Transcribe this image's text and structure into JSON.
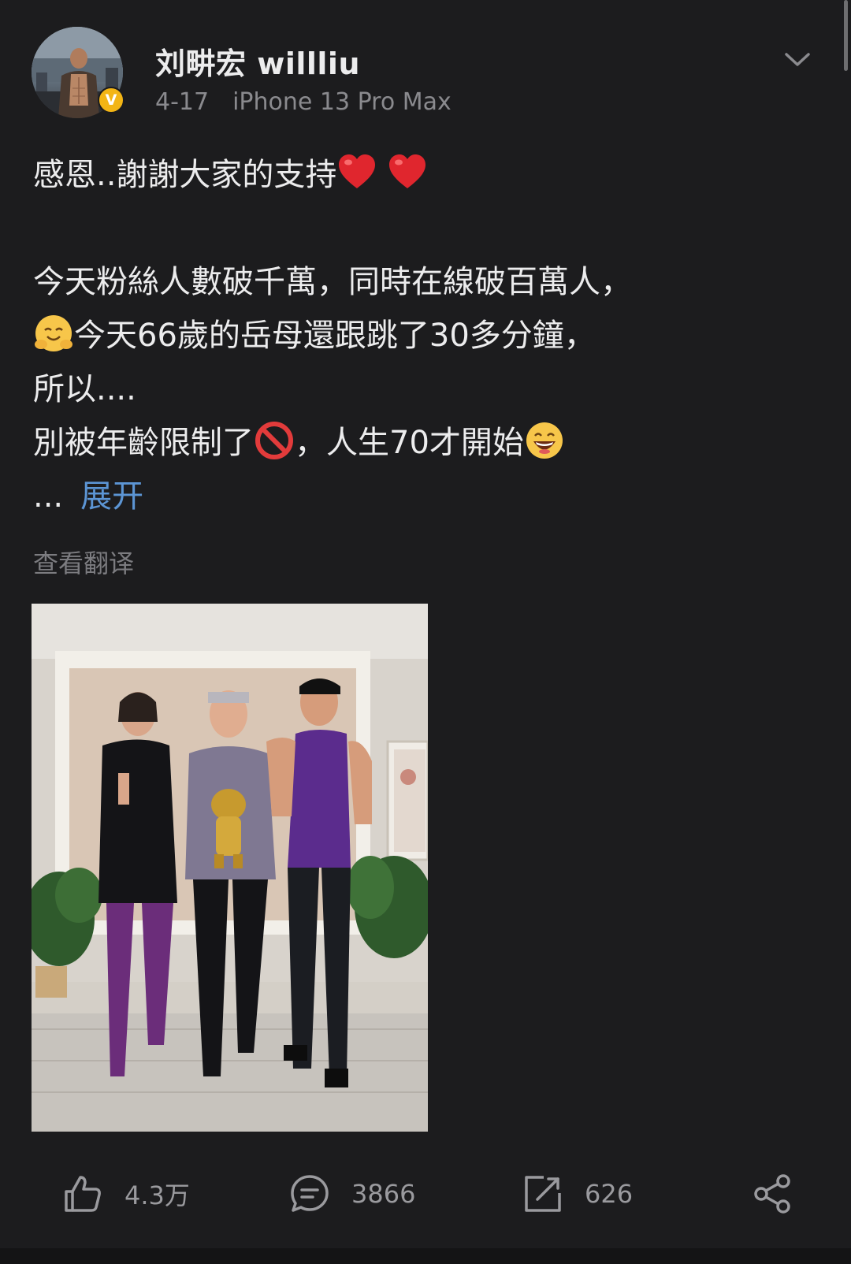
{
  "author": {
    "name": "刘畊宏 willliu",
    "verified_badge": "V",
    "avatar": "avatar-photo",
    "badge_color": "#f3b515"
  },
  "post": {
    "date": "4-17",
    "device": "iPhone 13 Pro Max",
    "lines": {
      "line1": "感恩..謝謝大家的支持",
      "line3": "今天粉絲人數破千萬，同時在線破百萬人，",
      "line4": "今天66歲的岳母還跟跳了30多分鐘，",
      "line5": "所以....",
      "line6a": "別被年齡限制了",
      "line6b": "，人生70才開始"
    },
    "truncation": "...",
    "expand_label": "展开",
    "translate_label": "查看翻译",
    "emojis": [
      "red-heart",
      "red-heart",
      "hugging-face",
      "prohibited",
      "grinning-face"
    ],
    "link_color": "#5c95d4"
  },
  "image": {
    "subject": "three people in purple and black workout clothes holding a gold figurine in a living room"
  },
  "actions": {
    "likes": "4.3万",
    "comments": "3866",
    "reposts": "626"
  },
  "icons": {
    "menu": "chevron-down-icon",
    "like": "thumbs-up-icon",
    "comment": "comment-icon",
    "repost": "repost-icon",
    "share": "share-icon"
  }
}
